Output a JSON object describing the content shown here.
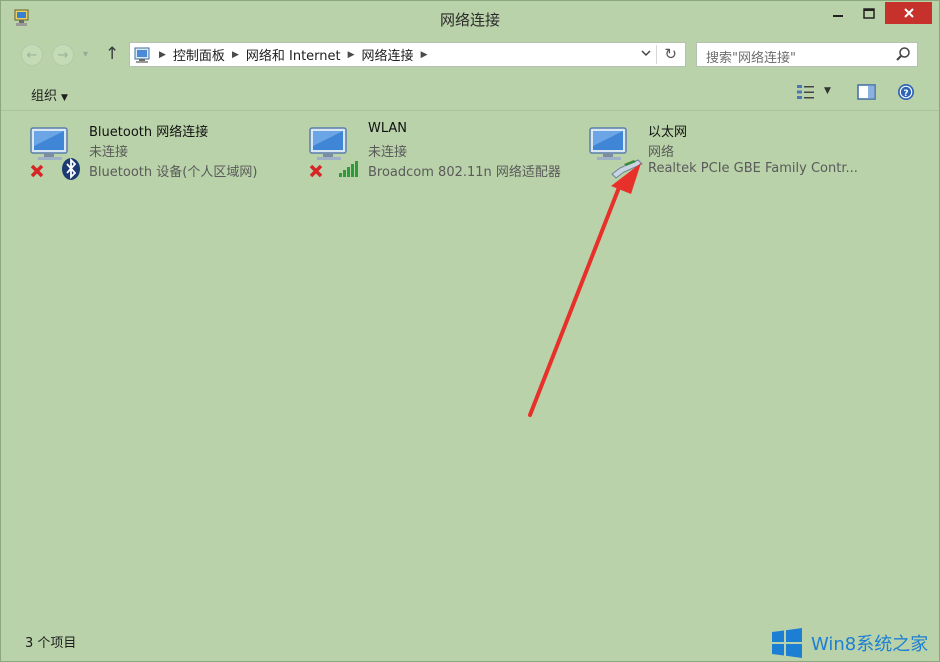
{
  "window": {
    "title": "网络连接"
  },
  "address_bar": {
    "breadcrumbs": [
      "控制面板",
      "网络和 Internet",
      "网络连接"
    ]
  },
  "search": {
    "placeholder": "搜索\"网络连接\""
  },
  "toolbar": {
    "organize_label": "组织"
  },
  "connections": [
    {
      "name": "Bluetooth 网络连接",
      "status": "未连接",
      "device": "Bluetooth 设备(个人区域网)",
      "icon": "bluetooth-adapter-icon",
      "state": "disconnected"
    },
    {
      "name": "WLAN",
      "status": "未连接",
      "device": "Broadcom 802.11n 网络适配器",
      "icon": "wireless-signal-icon",
      "state": "disconnected"
    },
    {
      "name": "以太网",
      "status": "网络",
      "device": "Realtek PCIe GBE Family Contr...",
      "icon": "ethernet-cable-icon",
      "state": "connected"
    }
  ],
  "statusbar": {
    "item_count": "3 个项目"
  },
  "watermark": {
    "text": "Win8系统之家"
  },
  "colors": {
    "window_frame": "#b9d2a9",
    "close_button": "#c7312c",
    "annotation_arrow": "#e8302b",
    "watermark_blue": "#1d7fd3"
  }
}
